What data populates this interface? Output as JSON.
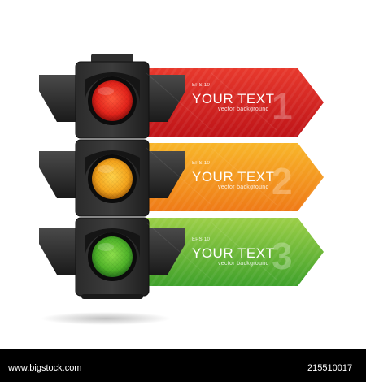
{
  "banners": [
    {
      "eps": "EPS 10",
      "title": "YOUR TEXT",
      "subtitle": "vector background",
      "number": "1",
      "color_top": "#e6332a",
      "color_bottom": "#c4161c"
    },
    {
      "eps": "EPS 10",
      "title": "YOUR TEXT",
      "subtitle": "vector background",
      "number": "2",
      "color_top": "#f7a51d",
      "color_bottom": "#f07e1a"
    },
    {
      "eps": "EPS 10",
      "title": "YOUR TEXT",
      "subtitle": "vector background",
      "number": "3",
      "color_top": "#8cc63f",
      "color_bottom": "#4daa2e"
    }
  ],
  "lights": [
    {
      "name": "red",
      "color": "#e3241b"
    },
    {
      "name": "yellow",
      "color": "#f4b021"
    },
    {
      "name": "green",
      "color": "#5db92e"
    }
  ],
  "watermark": {
    "site": "www.bigstock.com",
    "code": "215510017"
  }
}
